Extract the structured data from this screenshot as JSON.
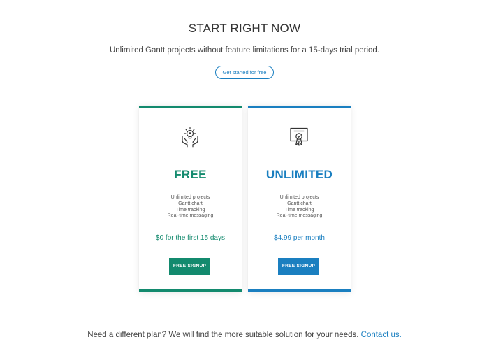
{
  "hero": {
    "title": "START RIGHT NOW",
    "subtitle": "Unlimited Gantt projects without feature limitations for a 15-days trial period.",
    "cta_label": "Get started for free"
  },
  "plans": [
    {
      "name": "FREE",
      "icon": "idea-hands-icon",
      "features": [
        "Unlimited projects",
        "Gantt chart",
        "Time tracking",
        "Real-time messaging"
      ],
      "price": "$0 for the first 15 days",
      "button_label": "FREE SIGNUP",
      "accent_color": "#138a6e"
    },
    {
      "name": "UNLIMITED",
      "icon": "certificate-icon",
      "features": [
        "Unlimited projects",
        "Gantt chart",
        "Time tracking",
        "Real-time messaging"
      ],
      "price": "$4.99 per month",
      "button_label": "FREE SIGNUP",
      "accent_color": "#1a7fc0"
    }
  ],
  "footer": {
    "text": "Need a different plan? We will find the more suitable solution for your needs.",
    "link_label": "Contact us."
  }
}
